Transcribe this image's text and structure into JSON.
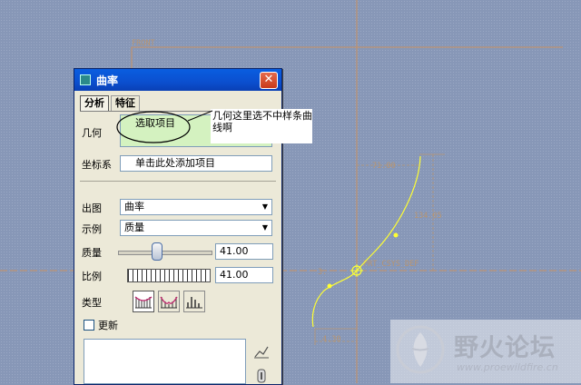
{
  "canvas": {
    "front_label": "FRONT",
    "csys_label": "PRT_CSYS_DEF",
    "dim_top": "71.00",
    "dim_right": "134.05",
    "dim_left_small": "3.",
    "dim_bottom": "4.30",
    "colors": {
      "background": "#8797b7",
      "datum": "#c89060",
      "curve": "#ffff33"
    }
  },
  "dialog": {
    "title": "曲率",
    "close_glyph": "✕",
    "tabs": [
      "分析",
      "特征"
    ],
    "geometry": {
      "label": "几何",
      "value": "选取项目"
    },
    "csys": {
      "label": "坐标系",
      "value": "单击此处添加项目"
    },
    "output": {
      "label": "出图",
      "value": "曲率"
    },
    "example": {
      "label": "示例",
      "value": "质量"
    },
    "quality": {
      "label": "质量",
      "value": "41.00",
      "slider_fraction": 0.41
    },
    "scale": {
      "label": "比例",
      "value": "41.00"
    },
    "type": {
      "label": "类型"
    },
    "update": {
      "label": "更新",
      "checked": false
    }
  },
  "callout": {
    "text": "几何这里选不中样条曲线啊"
  },
  "watermark": {
    "title": "野火论坛",
    "url": "www.proewildfire.cn"
  }
}
